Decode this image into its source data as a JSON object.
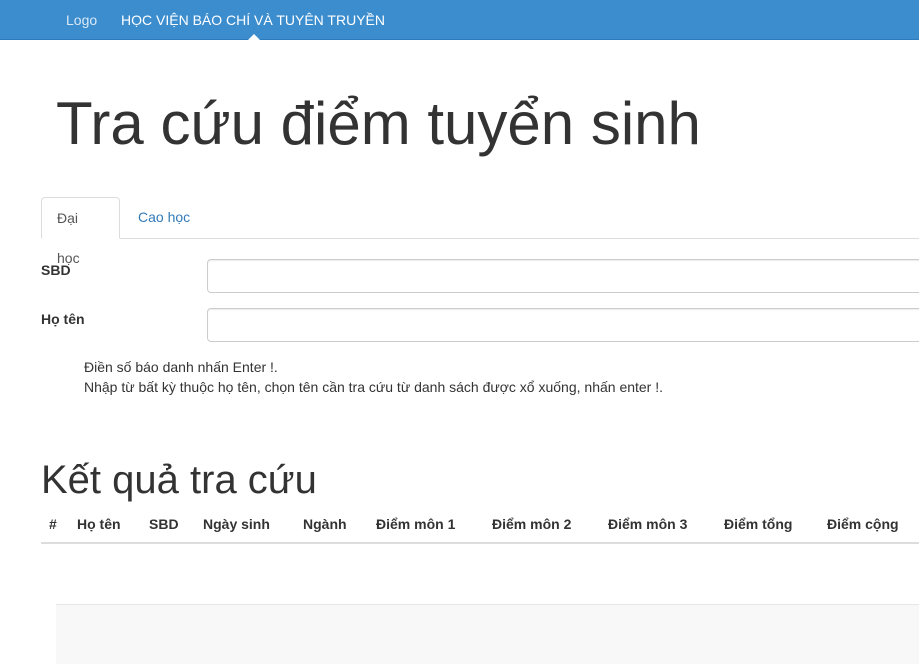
{
  "navbar": {
    "logo": "Logo",
    "brand": "HỌC VIỆN BÁO CHÍ VÀ TUYÊN TRUYỀN",
    "background": "#3c8dce"
  },
  "page_title": "Tra cứu điểm tuyển sinh",
  "tabs": [
    {
      "label": "Đại học",
      "active": true
    },
    {
      "label": "Cao học",
      "active": false
    }
  ],
  "form": {
    "sbd_label": "SBD",
    "sbd_value": "",
    "name_label": "Họ tên",
    "name_value": ""
  },
  "hints": [
    "Điền số báo danh nhấn Enter !.",
    "Nhập từ bất kỳ thuộc họ tên, chọn tên cần tra cứu từ danh sách được xổ xuống, nhấn enter !."
  ],
  "results": {
    "title": "Kết quả tra cứu",
    "columns": [
      "#",
      "Họ tên",
      "SBD",
      "Ngày sinh",
      "Ngành",
      "Điểm môn 1",
      "Điểm môn 2",
      "Điểm môn 3",
      "Điểm tổng",
      "Điểm cộng"
    ],
    "rows": []
  }
}
